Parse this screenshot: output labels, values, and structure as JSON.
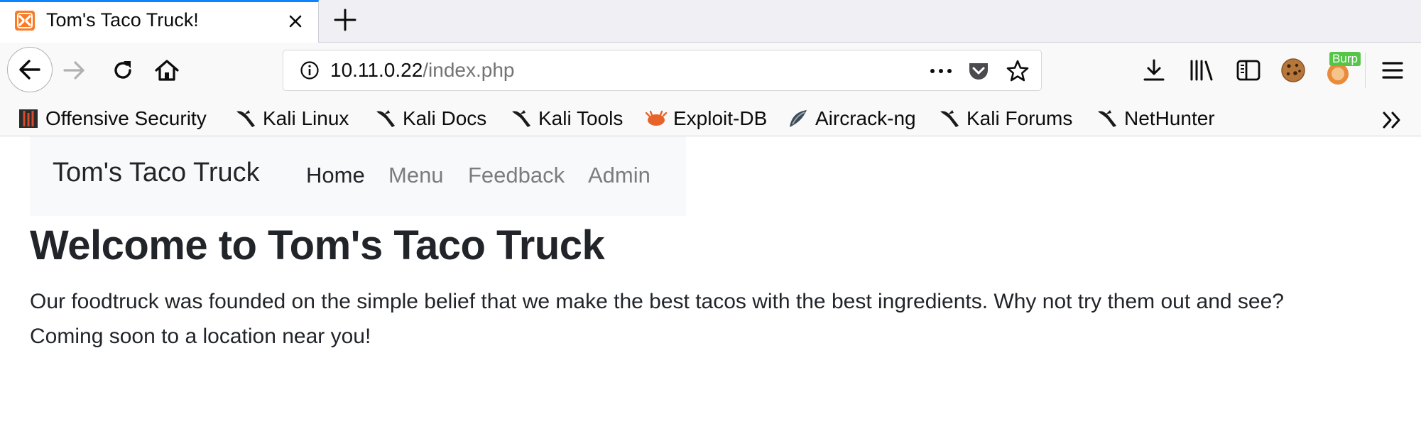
{
  "browser": {
    "tab": {
      "title": "Tom's Taco Truck!",
      "favicon": "xampp-icon",
      "accent_color": "#0a84ff"
    },
    "toolbar": {
      "url_host": "10.11.0.22",
      "url_path": "/index.php",
      "extensions": {
        "burp_label": "Burp",
        "burp_badge_color": "#55c548"
      }
    },
    "bookmarks": [
      {
        "label": "Offensive Security",
        "icon": "offsec-icon"
      },
      {
        "label": "Kali Linux",
        "icon": "kali-dragon-icon"
      },
      {
        "label": "Kali Docs",
        "icon": "kali-dragon-icon"
      },
      {
        "label": "Kali Tools",
        "icon": "kali-dragon-icon"
      },
      {
        "label": "Exploit-DB",
        "icon": "exploit-db-icon"
      },
      {
        "label": "Aircrack-ng",
        "icon": "aircrack-icon"
      },
      {
        "label": "Kali Forums",
        "icon": "kali-dragon-icon"
      },
      {
        "label": "NetHunter",
        "icon": "kali-dragon-icon"
      }
    ]
  },
  "page": {
    "brand": "Tom's Taco Truck",
    "nav": [
      {
        "label": "Home",
        "active": true
      },
      {
        "label": "Menu",
        "active": false
      },
      {
        "label": "Feedback",
        "active": false
      },
      {
        "label": "Admin",
        "active": false
      }
    ],
    "heading": "Welcome to Tom's Taco Truck",
    "intro_line1": "Our foodtruck was founded on the simple belief that we make the best tacos with the best ingredients. Why not try them out and see?",
    "intro_line2": "Coming soon to a location near you!"
  }
}
